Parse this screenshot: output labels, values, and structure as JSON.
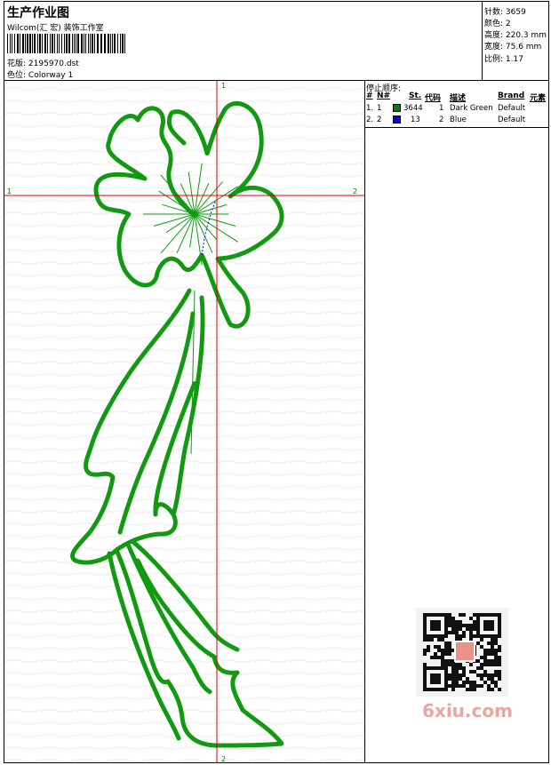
{
  "header": {
    "title": "生产作业图",
    "company": "Wilcom(汇 宏) 装饰工作室",
    "design_label": "花版:",
    "design_value": "2195970.dst",
    "colorway_label": "色位:",
    "colorway_value": "Colorway 1"
  },
  "stats": {
    "stitches": "针数: 3659",
    "colors": "颜色: 2",
    "height": "高度: 220.3 mm",
    "width": "宽度: 75.6 mm",
    "scale": "比例: 1.17"
  },
  "stop_sequence": {
    "title": "停止顺序:",
    "columns": [
      "#",
      "N#",
      "St.",
      "代码",
      "描述",
      "Brand",
      "元素"
    ],
    "rows": [
      {
        "idx": "1.",
        "n": "1",
        "color": "#008000",
        "st": "3644",
        "code": "1",
        "desc": "Dark Green",
        "brand": "Default"
      },
      {
        "idx": "2.",
        "n": "2",
        "color": "#0000ff",
        "st": "13",
        "code": "2",
        "desc": "Blue",
        "brand": "Default"
      }
    ]
  },
  "crosshair": {
    "top_label": "1",
    "bottom_label": "2",
    "left_label": "1",
    "right_label": "2",
    "color": "#e00000"
  },
  "watermark": {
    "text": "6xiu.com"
  },
  "colors": {
    "stitch_green": "#119a11",
    "stitch_blue": "#0000ff"
  }
}
